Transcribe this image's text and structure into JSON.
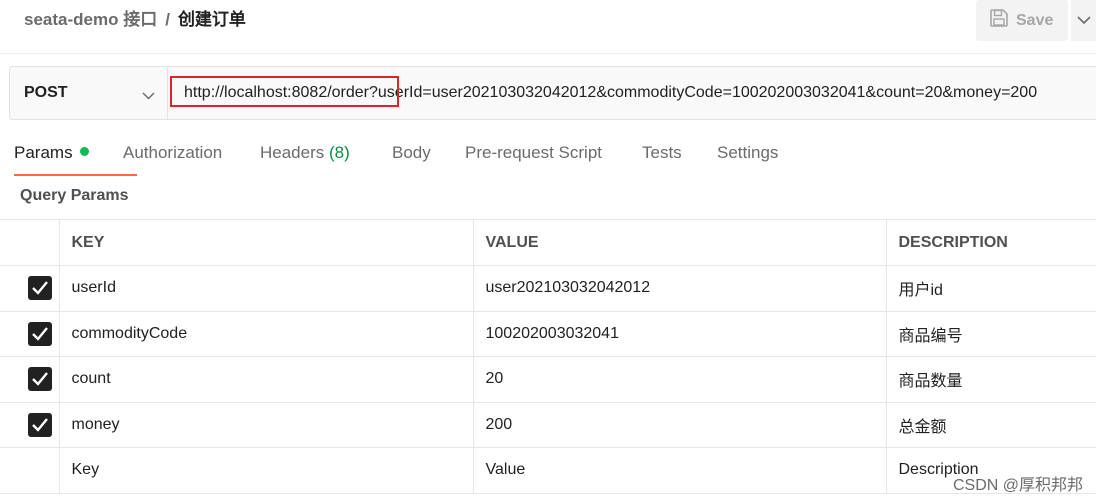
{
  "header": {
    "breadcrumb_parent": "seata-demo 接口",
    "breadcrumb_separator": "/",
    "breadcrumb_current": "创建订单",
    "save_label": "Save",
    "save_icon": "save-icon"
  },
  "request": {
    "method": "POST",
    "url": "http://localhost:8082/order?userId=user202103032042012&commodityCode=100202003032041&count=20&money=200"
  },
  "tabs": [
    {
      "label": "Params",
      "active": true
    },
    {
      "label": "Authorization"
    },
    {
      "label": "Headers",
      "count": "(8)"
    },
    {
      "label": "Body"
    },
    {
      "label": "Pre-request Script"
    },
    {
      "label": "Tests"
    },
    {
      "label": "Settings"
    }
  ],
  "query_params": {
    "title": "Query Params",
    "columns": {
      "key": "KEY",
      "value": "VALUE",
      "description": "DESCRIPTION"
    },
    "rows": [
      {
        "checked": true,
        "key": "userId",
        "value": "user202103032042012",
        "description": "用户id"
      },
      {
        "checked": true,
        "key": "commodityCode",
        "value": "100202003032041",
        "description": "商品编号"
      },
      {
        "checked": true,
        "key": "count",
        "value": "20",
        "description": "商品数量"
      },
      {
        "checked": true,
        "key": "money",
        "value": "200",
        "description": "总金额"
      }
    ],
    "placeholders": {
      "key": "Key",
      "value": "Value",
      "description": "Description"
    }
  },
  "watermark": "CSDN @厚积邦邦",
  "colors": {
    "accent": "#f26b3a",
    "dot": "#0cbb52",
    "highlight_box": "#d9262c"
  }
}
